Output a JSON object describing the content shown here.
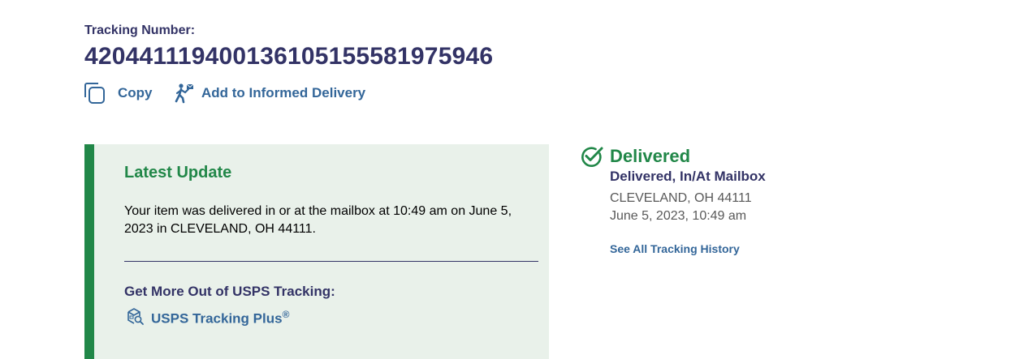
{
  "tracking": {
    "label": "Tracking Number:",
    "number": "420441119400136105155581975946",
    "actions": {
      "copy_label": "Copy",
      "copy_icon": "copy-icon",
      "informed_label": "Add to Informed Delivery",
      "informed_icon": "mail-carrier-icon"
    }
  },
  "latest_update": {
    "title": "Latest Update",
    "text": "Your item was delivered in or at the mailbox at 10:49 am on June 5, 2023 in CLEVELAND, OH 44111.",
    "more_title": "Get More Out of USPS Tracking:",
    "plus_label": "USPS Tracking Plus",
    "plus_mark": "®",
    "plus_icon": "package-search-icon"
  },
  "status": {
    "icon": "check-circle-icon",
    "title": "Delivered",
    "subtitle": "Delivered, In/At Mailbox",
    "location": "CLEVELAND, OH 44111",
    "datetime": "June 5, 2023, 10:49 am",
    "history_link": "See All Tracking History"
  },
  "colors": {
    "navy": "#333366",
    "link_blue": "#336699",
    "green": "#218748",
    "panel_bg": "#e9f1ea",
    "gray_text": "#595959"
  }
}
